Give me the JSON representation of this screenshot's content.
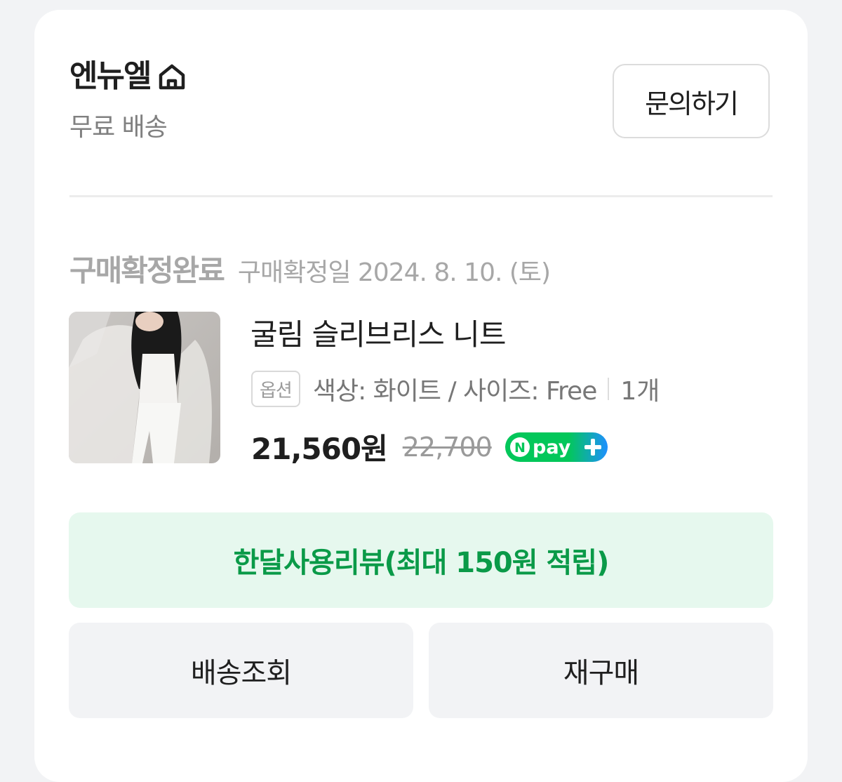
{
  "store": {
    "name": "엔뉴엘",
    "shipping": "무료 배송",
    "inquiry_label": "문의하기"
  },
  "order": {
    "status": "구매확정완료",
    "confirm_date": "구매확정일 2024. 8. 10. (토)"
  },
  "product": {
    "name": "굴림 슬리브리스 니트",
    "option_badge": "옵션",
    "option_text": "색상: 화이트 / 사이즈: Free",
    "quantity": "1개",
    "price": "21,560원",
    "original_price": "22,700",
    "pay_badge": "Npay+"
  },
  "actions": {
    "review_label": "한달사용리뷰(최대 150원 적립)",
    "tracking_label": "배송조회",
    "reorder_label": "재구매"
  },
  "colors": {
    "review_bg": "#e6f8ee",
    "review_text": "#0a9a48",
    "npay_green": "#03c75a",
    "npay_blue": "#1e90ff"
  }
}
